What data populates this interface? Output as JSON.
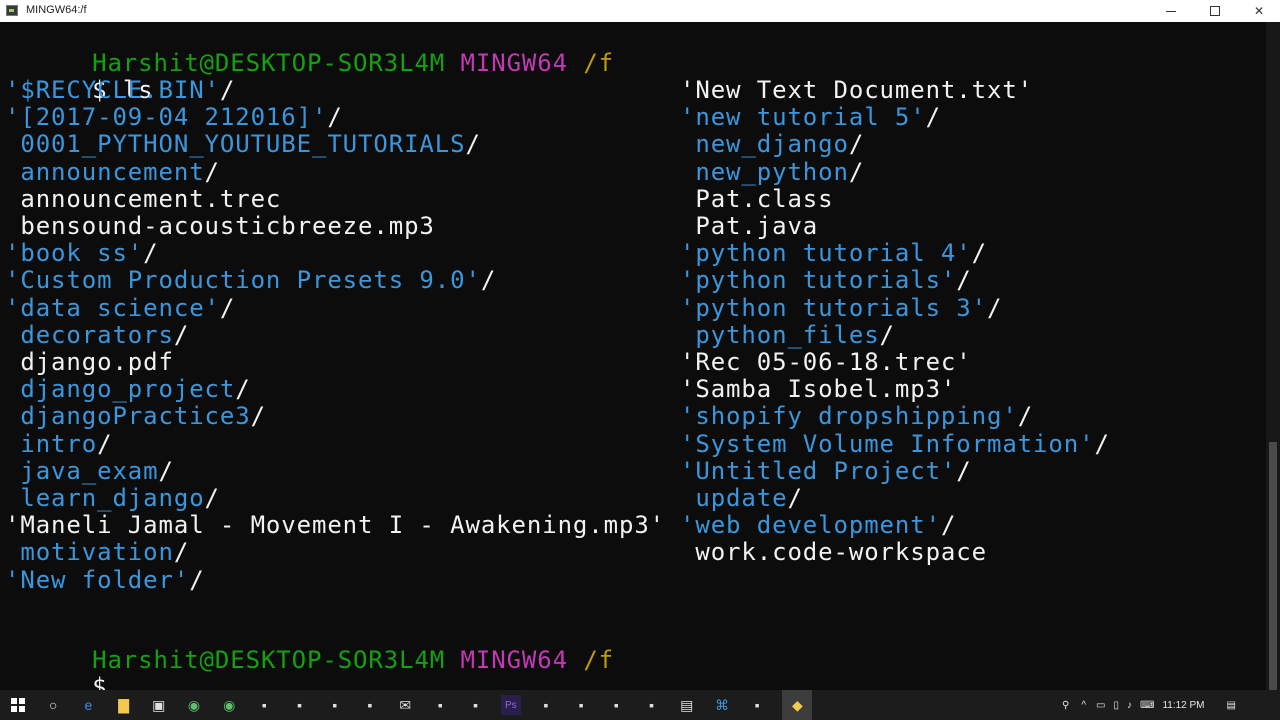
{
  "window": {
    "title": "MINGW64:/f"
  },
  "prompt": {
    "user_host": "Harshit@DESKTOP-SOR3L4M",
    "shell": "MINGW64",
    "path": "/f",
    "symbol": "$"
  },
  "command": "ls",
  "listing_left": [
    {
      "name": "'$RECYCLE.BIN'",
      "suffix": "/",
      "kind": "dir"
    },
    {
      "name": "'[2017-09-04 212016]'",
      "suffix": "/",
      "kind": "dir"
    },
    {
      "name": " 0001_PYTHON_YOUTUBE_TUTORIALS",
      "suffix": "/",
      "kind": "dir"
    },
    {
      "name": " announcement",
      "suffix": "/",
      "kind": "dir"
    },
    {
      "name": " announcement.trec",
      "suffix": "",
      "kind": "file"
    },
    {
      "name": " bensound-acousticbreeze.mp3",
      "suffix": "",
      "kind": "file"
    },
    {
      "name": "'book ss'",
      "suffix": "/",
      "kind": "dir"
    },
    {
      "name": "'Custom Production Presets 9.0'",
      "suffix": "/",
      "kind": "dir"
    },
    {
      "name": "'data science'",
      "suffix": "/",
      "kind": "dir"
    },
    {
      "name": " decorators",
      "suffix": "/",
      "kind": "dir"
    },
    {
      "name": " django.pdf",
      "suffix": "",
      "kind": "file"
    },
    {
      "name": " django_project",
      "suffix": "/",
      "kind": "dir"
    },
    {
      "name": " djangoPractice3",
      "suffix": "/",
      "kind": "dir"
    },
    {
      "name": " intro",
      "suffix": "/",
      "kind": "dir"
    },
    {
      "name": " java_exam",
      "suffix": "/",
      "kind": "dir"
    },
    {
      "name": " learn_django",
      "suffix": "/",
      "kind": "dir"
    },
    {
      "name": "'Maneli Jamal - Movement I - Awakening.mp3'",
      "suffix": "",
      "kind": "file"
    },
    {
      "name": " motivation",
      "suffix": "/",
      "kind": "dir"
    },
    {
      "name": "'New folder'",
      "suffix": "/",
      "kind": "dir"
    }
  ],
  "listing_right": [
    {
      "name": "'New Text Document.txt'",
      "suffix": "",
      "kind": "file"
    },
    {
      "name": "'new tutorial 5'",
      "suffix": "/",
      "kind": "dir"
    },
    {
      "name": " new_django",
      "suffix": "/",
      "kind": "dir"
    },
    {
      "name": " new_python",
      "suffix": "/",
      "kind": "dir"
    },
    {
      "name": " Pat.class",
      "suffix": "",
      "kind": "file"
    },
    {
      "name": " Pat.java",
      "suffix": "",
      "kind": "file"
    },
    {
      "name": "'python tutorial 4'",
      "suffix": "/",
      "kind": "dir"
    },
    {
      "name": "'python tutorials'",
      "suffix": "/",
      "kind": "dir"
    },
    {
      "name": "'python tutorials 3'",
      "suffix": "/",
      "kind": "dir"
    },
    {
      "name": " python_files",
      "suffix": "/",
      "kind": "dir"
    },
    {
      "name": "'Rec 05-06-18.trec'",
      "suffix": "",
      "kind": "file"
    },
    {
      "name": "'Samba Isobel.mp3'",
      "suffix": "",
      "kind": "file"
    },
    {
      "name": "'shopify dropshipping'",
      "suffix": "/",
      "kind": "dir"
    },
    {
      "name": "'System Volume Information'",
      "suffix": "/",
      "kind": "dir"
    },
    {
      "name": "'Untitled Project'",
      "suffix": "/",
      "kind": "dir"
    },
    {
      "name": " update",
      "suffix": "/",
      "kind": "dir"
    },
    {
      "name": "'web development'",
      "suffix": "/",
      "kind": "dir"
    },
    {
      "name": " work.code-workspace",
      "suffix": "",
      "kind": "file"
    }
  ],
  "colors": {
    "background": "#0c0c0c",
    "user_host": "#13a10e",
    "shell": "#c239b3",
    "path": "#c19c00",
    "directory": "#3a96dd",
    "file": "#f2f2f2"
  },
  "taskbar": {
    "clock": "11:12 PM",
    "icons": [
      "windows-start-icon",
      "search-icon",
      "edge-icon",
      "file-explorer-icon",
      "store-icon",
      "chrome-icon",
      "chrome-icon",
      "app-icon",
      "app-icon",
      "app-icon",
      "app-icon",
      "mail-icon",
      "app-icon",
      "app-icon",
      "photoshop-icon",
      "app-icon",
      "app-icon",
      "app-icon",
      "app-icon",
      "notepad-icon",
      "vscode-icon",
      "app-icon",
      "git-bash-icon"
    ]
  }
}
